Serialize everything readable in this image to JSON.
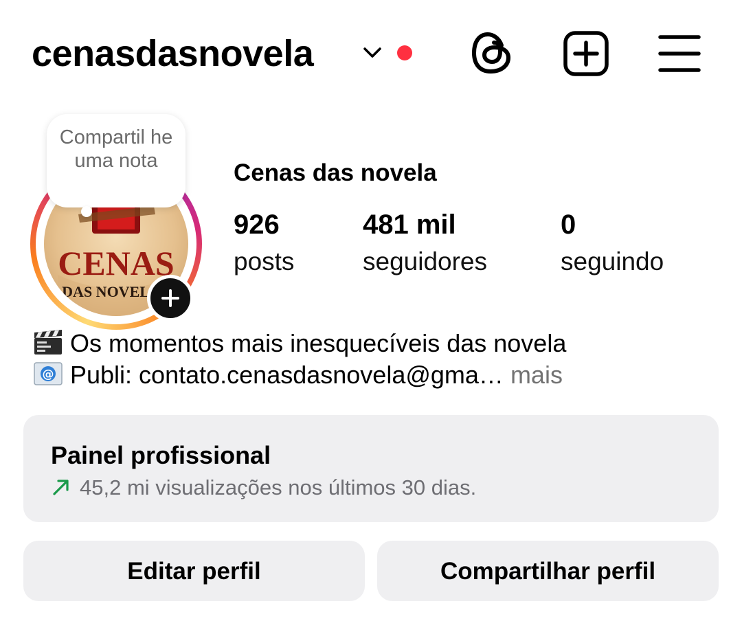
{
  "header": {
    "username": "cenasdasnovela",
    "icons": [
      "chevron-down-icon",
      "notification-dot",
      "threads-icon",
      "add-content-icon",
      "menu-icon"
    ],
    "notification_color": "#ff3040"
  },
  "note": {
    "text": "Compartil he uma nota"
  },
  "avatar": {
    "logo_line1": "CENAS",
    "logo_line2": "DAS NOVELA"
  },
  "profile": {
    "display_name": "Cenas das novela",
    "stats": [
      {
        "value": "926",
        "label": "posts"
      },
      {
        "value": "481 mil",
        "label": "seguidores"
      },
      {
        "value": "0",
        "label": "seguindo"
      }
    ]
  },
  "bio": {
    "line1_icon": "clapperboard-emoji",
    "line1": "Os momentos mais inesquecíveis das novela",
    "line2_icon": "email-emoji",
    "line2": "Publi: contato.cenasdasnovela@gma…",
    "more": "mais"
  },
  "dashboard": {
    "title": "Painel profissional",
    "trend_icon": "arrow-up-right-icon",
    "trend_color": "#1a9a4a",
    "subtitle": "45,2 mi visualizações nos últimos 30 dias."
  },
  "buttons": {
    "edit": "Editar perfil",
    "share": "Compartilhar perfil"
  }
}
